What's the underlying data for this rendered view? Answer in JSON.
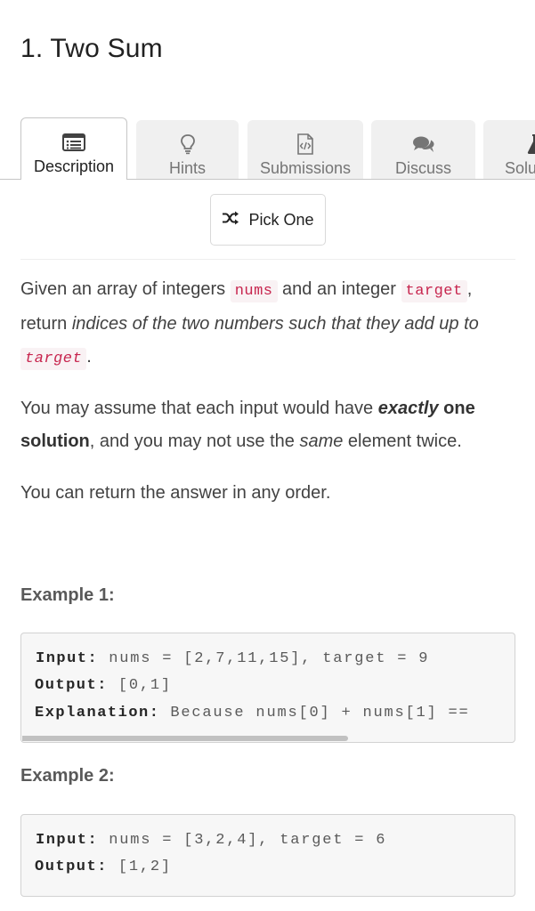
{
  "problem": {
    "title": "1. Two Sum"
  },
  "tabs": [
    {
      "label": "Description",
      "icon": "description-icon"
    },
    {
      "label": "Hints",
      "icon": "lightbulb-icon"
    },
    {
      "label": "Submissions",
      "icon": "code-file-icon"
    },
    {
      "label": "Discuss",
      "icon": "chat-icon"
    },
    {
      "label": "Solu",
      "icon": "flask-icon"
    }
  ],
  "pick_one": {
    "label": "Pick One",
    "icon": "shuffle-icon"
  },
  "description": {
    "p1": {
      "t1": "Given an array of integers ",
      "code1": "nums",
      "t2": " and an integer ",
      "code2": "target",
      "t3": ", return ",
      "em1": "indices of the two numbers such that they add up to",
      "t4": " ",
      "code3": "target",
      "t5": "."
    },
    "p2": {
      "t1": "You may assume that each input would have ",
      "em_bold": "exactly",
      "bold": " one solution",
      "t2": ", and you may not use the ",
      "em": "same",
      "t3": " element twice."
    },
    "p3": "You can return the answer in any order."
  },
  "examples": [
    {
      "title": "Example 1:",
      "input_label": "Input:",
      "input_value": " nums = [2,7,11,15], target = 9",
      "output_label": "Output:",
      "output_value": " [0,1]",
      "explanation_label": "Explanation:",
      "explanation_value": " Because nums[0] + nums[1] =="
    },
    {
      "title": "Example 2:",
      "input_label": "Input:",
      "input_value": " nums = [3,2,4], target = 6",
      "output_label": "Output:",
      "output_value": " [1,2]"
    }
  ],
  "colors": {
    "inline_code_text": "#c7254e",
    "inline_code_bg": "#f9f2f4",
    "pre_bg": "#f7f7f7"
  }
}
